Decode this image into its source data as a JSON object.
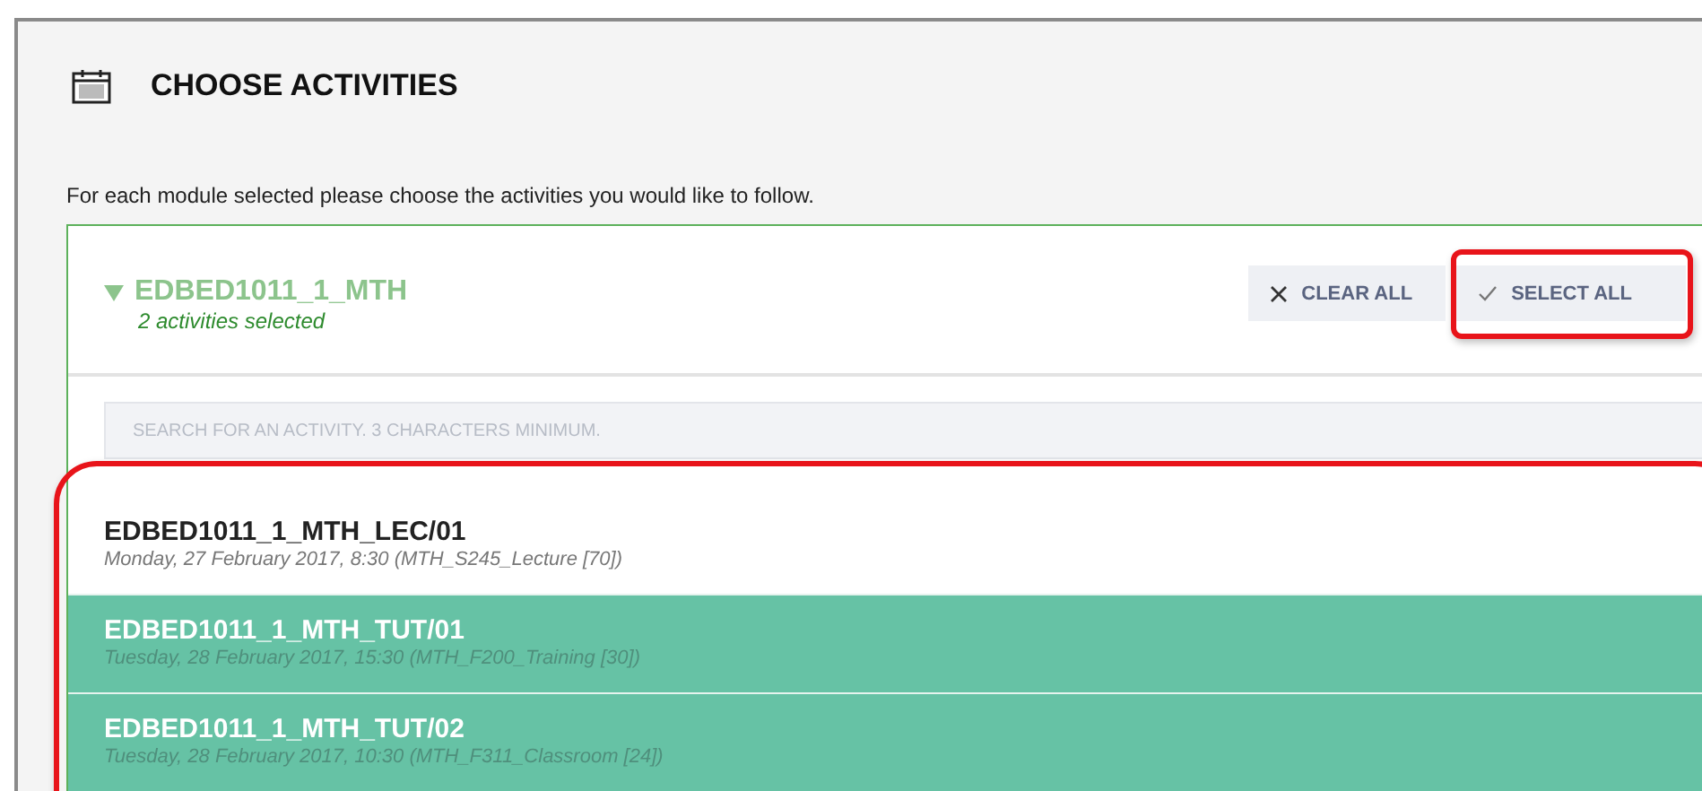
{
  "title": "CHOOSE ACTIVITIES",
  "instructions": "For each module selected please choose the activities you would like to follow.",
  "module": {
    "code": "EDBED1011_1_MTH",
    "expanded": true,
    "summary": "2 activities selected",
    "buttons": [
      {
        "kind": "clear",
        "label": "CLEAR ALL",
        "highlighted": false
      },
      {
        "kind": "select",
        "label": "SELECT ALL",
        "highlighted": true
      }
    ],
    "search": {
      "placeholder": "SEARCH FOR AN ACTIVITY. 3 CHARACTERS MINIMUM."
    },
    "activities_highlighted": true,
    "activities": [
      {
        "code": "EDBED1011_1_MTH_LEC/01",
        "details": "Monday, 27 February 2017, 8:30 (MTH_S245_Lecture [70])",
        "selected": false
      },
      {
        "code": "EDBED1011_1_MTH_TUT/01",
        "details": "Tuesday, 28 February 2017, 15:30 (MTH_F200_Training [30])",
        "selected": true
      },
      {
        "code": "EDBED1011_1_MTH_TUT/02",
        "details": "Tuesday, 28 February 2017, 10:30 (MTH_F311_Classroom [24])",
        "selected": true
      }
    ]
  }
}
